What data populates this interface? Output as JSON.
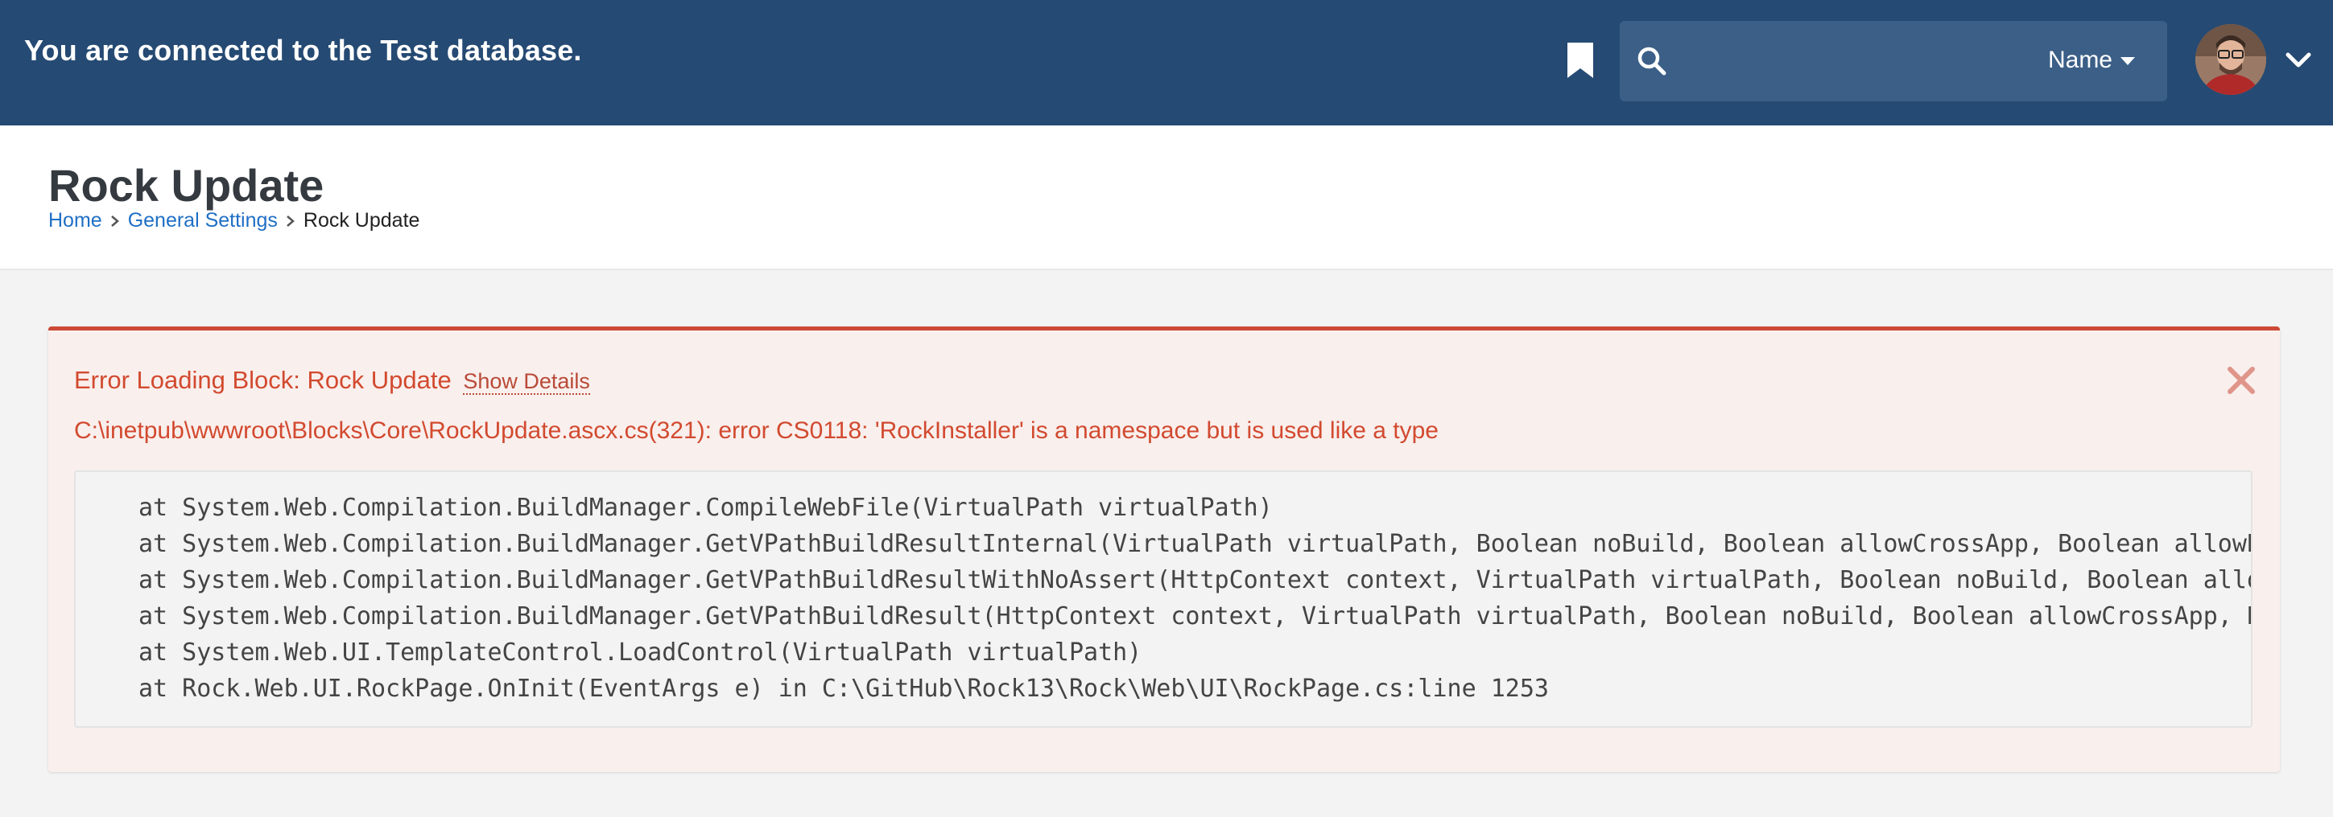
{
  "navbar": {
    "message": "You are connected to the Test database.",
    "bookmark_icon": "bookmark-icon",
    "search": {
      "placeholder": "",
      "value": "",
      "filter_label": "Name"
    },
    "user_menu_icon": "chevron-down-icon"
  },
  "page": {
    "title": "Rock Update",
    "breadcrumb": [
      "Home",
      "General Settings",
      "Rock Update"
    ]
  },
  "error": {
    "title": "Error Loading Block: Rock Update",
    "show_details_label": "Show Details",
    "message": "C:\\inetpub\\wwwroot\\Blocks\\Core\\RockUpdate.ascx.cs(321): error CS0118: 'RockInstaller' is a namespace but is used like a type",
    "stack": [
      "at System.Web.Compilation.BuildManager.CompileWebFile(VirtualPath virtualPath)",
      "at System.Web.Compilation.BuildManager.GetVPathBuildResultInternal(VirtualPath virtualPath, Boolean noBuild, Boolean allowCrossApp, Boolean allowB",
      "at System.Web.Compilation.BuildManager.GetVPathBuildResultWithNoAssert(HttpContext context, VirtualPath virtualPath, Boolean noBuild, Boolean allo",
      "at System.Web.Compilation.BuildManager.GetVPathBuildResult(HttpContext context, VirtualPath virtualPath, Boolean noBuild, Boolean allowCrossApp, B",
      "at System.Web.UI.TemplateControl.LoadControl(VirtualPath virtualPath)",
      "at Rock.Web.UI.RockPage.OnInit(EventArgs e) in C:\\GitHub\\Rock13\\Rock\\Web\\UI\\RockPage.cs:line 1253"
    ]
  },
  "colors": {
    "navbar": "#254a73",
    "error_accent": "#cc4935",
    "link": "#1f6fc5"
  }
}
